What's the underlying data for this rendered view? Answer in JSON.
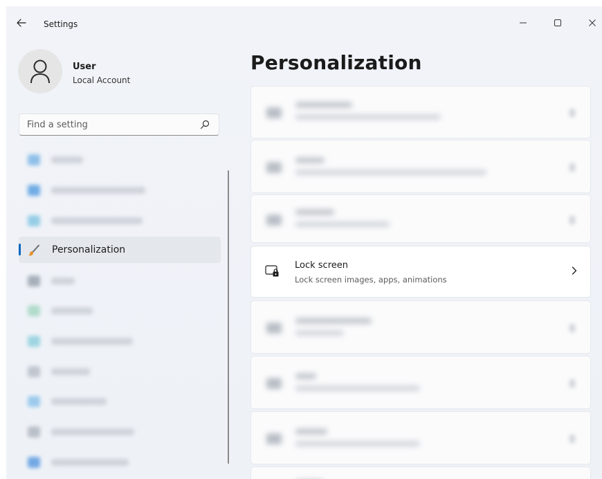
{
  "window": {
    "title": "Settings"
  },
  "titlebar": {
    "back_icon": "back-arrow-icon",
    "minimize_icon": "minimize-icon",
    "maximize_icon": "maximize-icon",
    "close_icon": "close-icon"
  },
  "profile": {
    "name": "User",
    "account_type": "Local Account",
    "avatar_icon": "person-icon"
  },
  "search": {
    "placeholder": "Find a setting",
    "icon": "search-icon"
  },
  "sidebar": {
    "active_item": {
      "label": "Personalization",
      "icon": "paintbrush-icon"
    },
    "accent_color": "#0067c0"
  },
  "main": {
    "title": "Personalization",
    "lock_screen": {
      "title": "Lock screen",
      "description": "Lock screen images, apps, animations",
      "icon": "lock-screen-icon",
      "chevron_icon": "chevron-right-icon"
    }
  }
}
